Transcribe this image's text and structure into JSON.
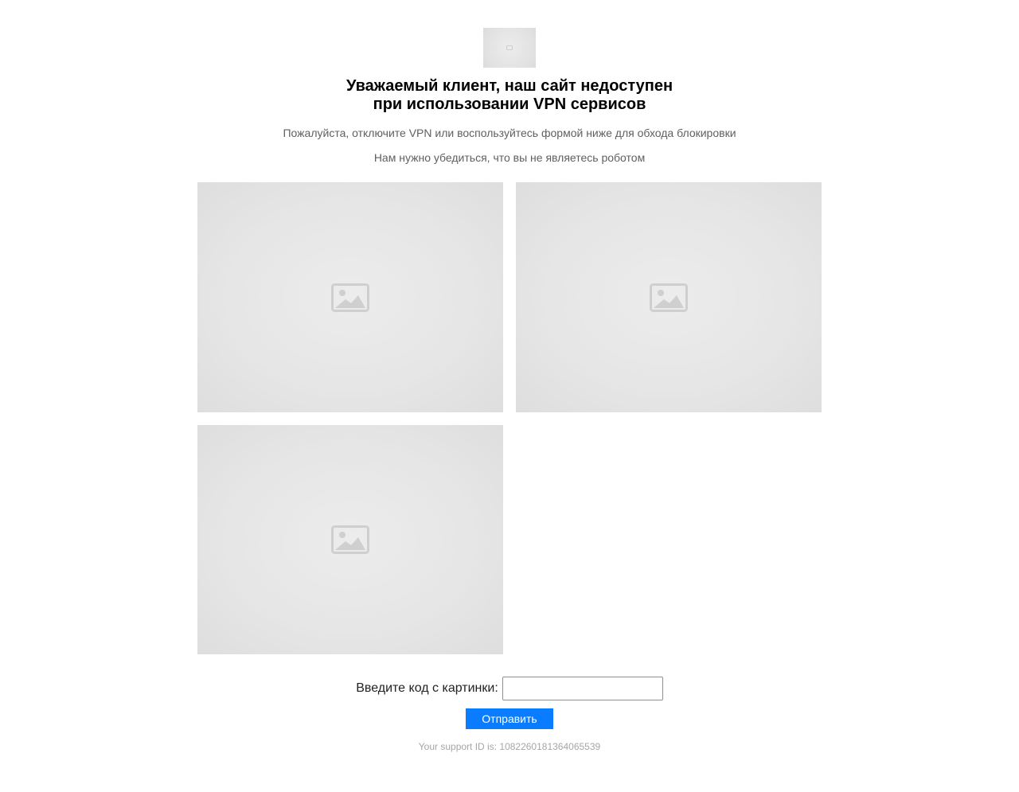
{
  "logo": {
    "icon": "logo-image-placeholder"
  },
  "header": {
    "title_line1": "Уважаемый клиент, наш сайт недоступен",
    "title_line2": "при использовании VPN сервисов",
    "subtitle": "Пожалуйста, отключите VPN или воспользуйтесь формой ниже для обхода блокировки",
    "robot_check": "Нам нужно убедиться, что вы не являетесь роботом"
  },
  "captcha": {
    "images": [
      {
        "icon": "image-placeholder-icon"
      },
      {
        "icon": "image-placeholder-icon"
      },
      {
        "icon": "image-placeholder-icon"
      }
    ]
  },
  "form": {
    "code_label": "Введите код с картинки:",
    "code_value": "",
    "submit_label": "Отправить"
  },
  "footer": {
    "support_id": "Your support ID is: 1082260181364065539"
  },
  "colors": {
    "button": "#0a7cff",
    "button_text": "#ffffff",
    "muted_text": "#5f5f5f",
    "support_text": "#a6a6a6",
    "placeholder_bg": "#e6e6e6"
  }
}
